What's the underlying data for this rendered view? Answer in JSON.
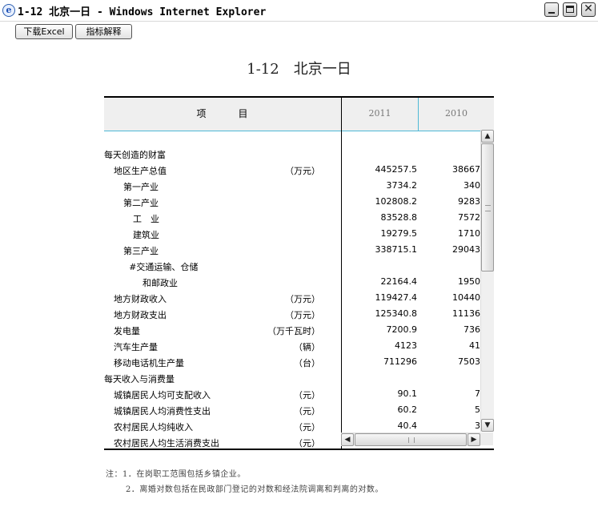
{
  "window": {
    "title": "1-12 北京一日 - Windows Internet Explorer",
    "app_icon": "ie-icon"
  },
  "toolbar": {
    "excel_label": "下载Excel",
    "explain_label": "指标解释"
  },
  "page": {
    "title": "1-12　北京一日"
  },
  "table": {
    "header": {
      "item": "项　　　目",
      "years": [
        "2011",
        "2010"
      ]
    },
    "rows": [
      {
        "label": "每天创造的财富",
        "indent": 0,
        "unit": "",
        "v2011": "",
        "v2010": ""
      },
      {
        "label": "地区生产总值",
        "indent": 1,
        "unit": "（万元）",
        "v2011": "445257.5",
        "v2010": "38667"
      },
      {
        "label": "第一产业",
        "indent": 2,
        "unit": "",
        "v2011": "3734.2",
        "v2010": "340"
      },
      {
        "label": "第二产业",
        "indent": 2,
        "unit": "",
        "v2011": "102808.2",
        "v2010": "9283"
      },
      {
        "label": "工　业",
        "indent": 3,
        "unit": "",
        "v2011": "83528.8",
        "v2010": "7572"
      },
      {
        "label": "建筑业",
        "indent": 3,
        "unit": "",
        "v2011": "19279.5",
        "v2010": "1710"
      },
      {
        "label": "第三产业",
        "indent": 2,
        "unit": "",
        "v2011": "338715.1",
        "v2010": "29043"
      },
      {
        "label": "#交通运输、仓储",
        "indent": 2.6,
        "unit": "",
        "v2011": "",
        "v2010": ""
      },
      {
        "label": "和邮政业",
        "indent": 4,
        "unit": "",
        "v2011": "22164.4",
        "v2010": "1950"
      },
      {
        "label": "地方财政收入",
        "indent": 1,
        "unit": "（万元）",
        "v2011": "119427.4",
        "v2010": "10440"
      },
      {
        "label": "地方财政支出",
        "indent": 1,
        "unit": "（万元）",
        "v2011": "125340.8",
        "v2010": "11136"
      },
      {
        "label": "发电量",
        "indent": 1,
        "unit": "（万千瓦时）",
        "v2011": "7200.9",
        "v2010": "736"
      },
      {
        "label": "汽车生产量",
        "indent": 1,
        "unit": "（辆）",
        "v2011": "4123",
        "v2010": "41"
      },
      {
        "label": "移动电话机生产量",
        "indent": 1,
        "unit": "（台）",
        "v2011": "711296",
        "v2010": "7503"
      },
      {
        "label": "每天收入与消费量",
        "indent": 0,
        "unit": "",
        "v2011": "",
        "v2010": ""
      },
      {
        "label": "城镇居民人均可支配收入",
        "indent": 1,
        "unit": "（元）",
        "v2011": "90.1",
        "v2010": "7"
      },
      {
        "label": "城镇居民人均消费性支出",
        "indent": 1,
        "unit": "（元）",
        "v2011": "60.2",
        "v2010": "5"
      },
      {
        "label": "农村居民人均纯收入",
        "indent": 1,
        "unit": "（元）",
        "v2011": "40.4",
        "v2010": "3"
      },
      {
        "label": "农村居民人均生活消费支出",
        "indent": 1,
        "unit": "（元）",
        "v2011": "",
        "v2010": ""
      }
    ]
  },
  "scrollbars": {
    "up": "▲",
    "down": "▼",
    "left": "◀",
    "right": "▶"
  },
  "notes": [
    "注：1．在岗职工范围包括乡镇企业。",
    "2．离婚对数包括在民政部门登记的对数和经法院调离和判离的对数。"
  ],
  "colors": {
    "header_bg": "#efefef",
    "header_line": "#4fb8d6",
    "rule": "#000000"
  }
}
